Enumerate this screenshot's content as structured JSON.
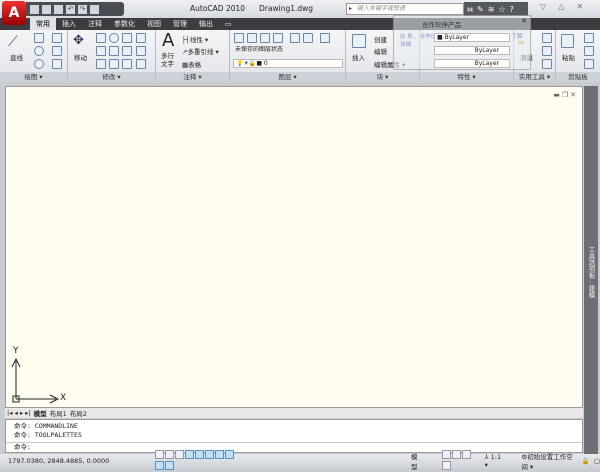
{
  "app": {
    "title": "AutoCAD 2010",
    "document": "Drawing1.dwg",
    "logo": "A"
  },
  "search": {
    "placeholder": "键入关键字或短语"
  },
  "tabs": [
    "常用",
    "插入",
    "注释",
    "参数化",
    "视图",
    "管理",
    "输出"
  ],
  "active_tab": "常用",
  "ribbon": {
    "draw": {
      "title": "绘图 ▾",
      "line": "直线"
    },
    "modify": {
      "title": "修改 ▾",
      "move": "移动"
    },
    "annotation": {
      "title": "注释 ▾",
      "text": "多行\n文字",
      "linear": "线性 ▾",
      "mleader": "多重引线 ▾",
      "table": "表格"
    },
    "layers": {
      "title": "图层 ▾",
      "layer_state": "未保存的图层状态",
      "layer": "0"
    },
    "block": {
      "title": "块 ▾",
      "insert": "插入",
      "create": "创建",
      "edit": "编辑",
      "edit_attr": "编辑属性 ▾"
    },
    "properties": {
      "title": "特性 ▾",
      "color": "ByLayer",
      "linetype": "ByLayer",
      "lineweight": "ByLayer"
    },
    "utilities": {
      "title": "实用工具 ▾",
      "measure": "测量"
    },
    "clipboard": {
      "title": "剪贴板",
      "paste": "粘贴"
    }
  },
  "tooltip": {
    "title": "合作伙伴产品",
    "body": "此 条... 合作伙伴产品 有关 AutoCAD 解决... 了解详细"
  },
  "canvas": {
    "background": "#fffcf0",
    "axis_x": "X",
    "axis_y": "Y"
  },
  "palette": {
    "label": "工具选项板 - 建模"
  },
  "layout_tabs": [
    "模型",
    "布局1",
    "布局2"
  ],
  "command": {
    "lines": [
      "命令: COMMANDLINE",
      "命令: TOOLPALETTES"
    ],
    "prompt": "命令:"
  },
  "status": {
    "coords": "1797.0380, 2848.4885, 0.0000",
    "model": "模型",
    "scale": "1:1 ▾",
    "workspace": "初始设置工作空间 ▾"
  }
}
